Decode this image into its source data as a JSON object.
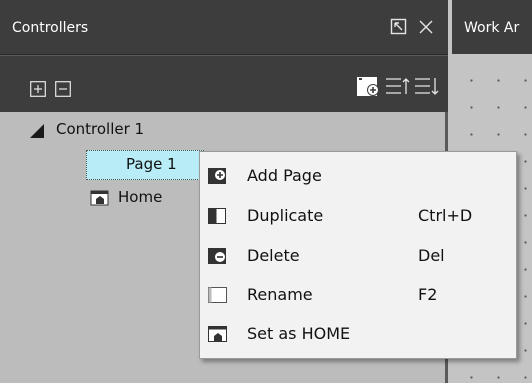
{
  "panel": {
    "title": "Controllers",
    "header_icons": [
      "popout-icon",
      "close-icon"
    ],
    "toolbar_icons": [
      "expand-all-icon",
      "collapse-all-icon",
      "add-page-icon",
      "sort-ascending-icon",
      "sort-descending-icon"
    ]
  },
  "tree": {
    "controller_label": "Controller 1",
    "page_label": "Page 1",
    "home_label": "Home"
  },
  "work_area": {
    "title": "Work Ar"
  },
  "context_menu": {
    "items": [
      {
        "label": "Add Page",
        "shortcut": "",
        "icon": "add-page-icon"
      },
      {
        "label": "Duplicate",
        "shortcut": "Ctrl+D",
        "icon": "duplicate-icon"
      },
      {
        "label": "Delete",
        "shortcut": "Del",
        "icon": "delete-icon"
      },
      {
        "label": "Rename",
        "shortcut": "F2",
        "icon": "rename-icon"
      },
      {
        "label": "Set as HOME",
        "shortcut": "",
        "icon": "set-home-icon"
      }
    ]
  },
  "colors": {
    "header_bg": "#3d3d3d",
    "tree_bg": "#bcbcbc",
    "selection_bg": "#b8ecf6",
    "menu_bg": "#f2f2f2"
  }
}
